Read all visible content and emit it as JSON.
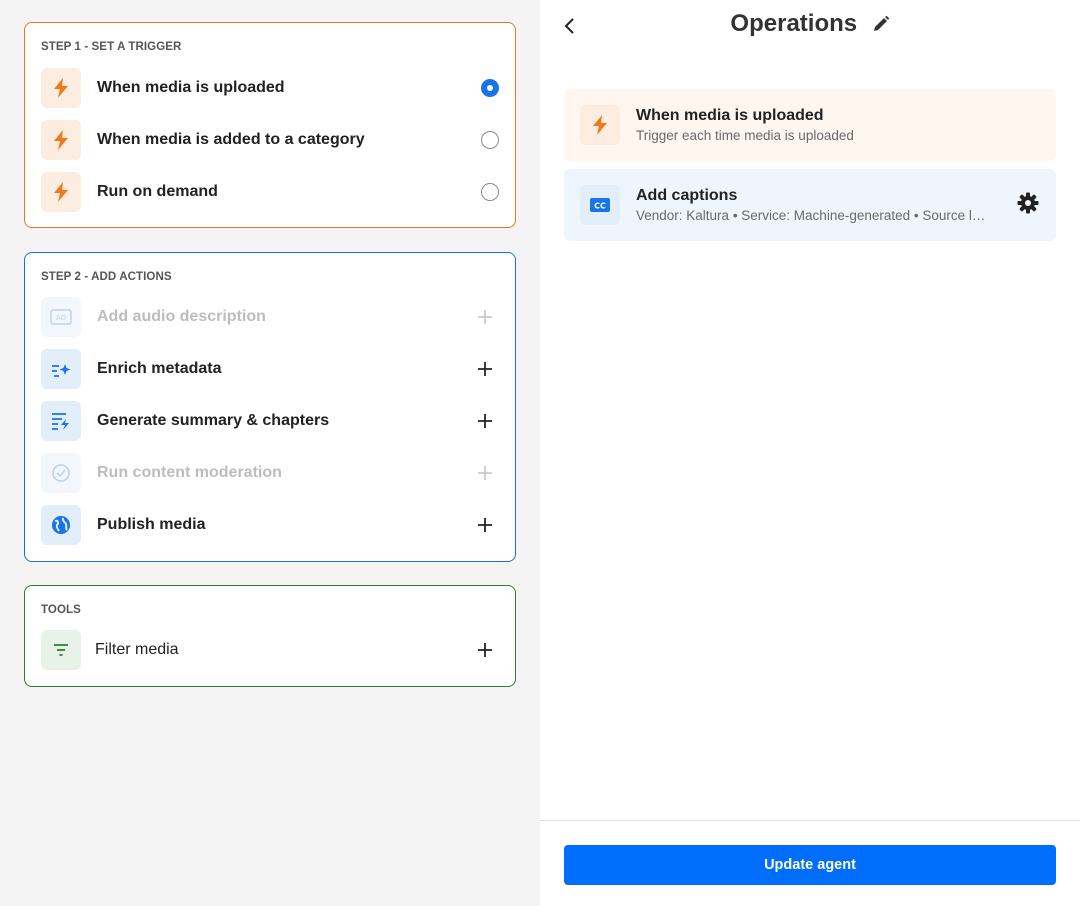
{
  "step1": {
    "title": "STEP 1 - SET A TRIGGER",
    "items": [
      {
        "label": "When media is uploaded",
        "icon": "lightning-icon",
        "selected": true
      },
      {
        "label": "When media is added to a category",
        "icon": "lightning-icon",
        "selected": false
      },
      {
        "label": "Run on demand",
        "icon": "lightning-icon",
        "selected": false
      }
    ]
  },
  "step2": {
    "title": "STEP 2 - ADD ACTIONS",
    "items": [
      {
        "label": "Add audio description",
        "icon": "audio-description-icon",
        "enabled": false
      },
      {
        "label": "Enrich metadata",
        "icon": "sparkle-metadata-icon",
        "enabled": true
      },
      {
        "label": "Generate summary & chapters",
        "icon": "summary-lightning-icon",
        "enabled": true
      },
      {
        "label": "Run content moderation",
        "icon": "check-circle-icon",
        "enabled": false
      },
      {
        "label": "Publish media",
        "icon": "globe-icon",
        "enabled": true
      }
    ]
  },
  "tools": {
    "title": "TOOLS",
    "items": [
      {
        "label": "Filter media",
        "icon": "filter-icon"
      }
    ]
  },
  "operations": {
    "title": "Operations",
    "trigger_card": {
      "title": "When media is uploaded",
      "subtitle": "Trigger each time media is uploaded",
      "icon": "lightning-icon"
    },
    "action_card": {
      "title": "Add captions",
      "subtitle": "Vendor: Kaltura • Service: Machine-generated • Source language: Auto-detect",
      "icon": "cc-icon"
    },
    "update_button": "Update agent"
  },
  "colors": {
    "trigger_border": "#e07b24",
    "actions_border": "#1f6fd1",
    "tools_border": "#2e7d32",
    "accent": "#006efa",
    "lightning": "#f07a1a"
  }
}
